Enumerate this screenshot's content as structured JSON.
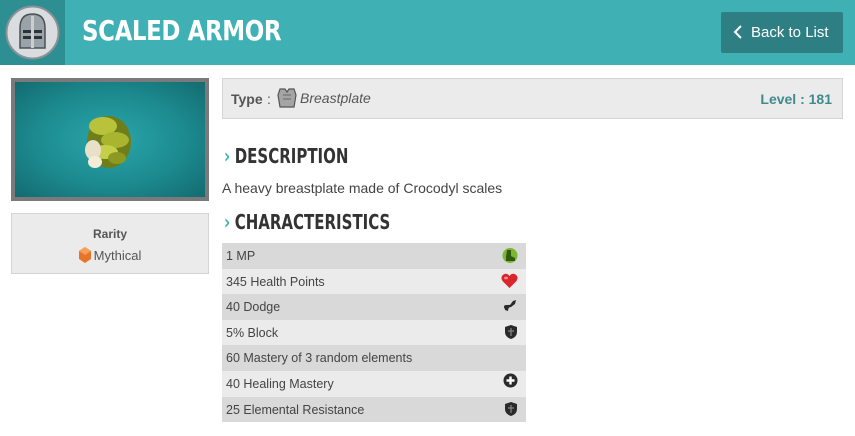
{
  "header": {
    "title": "Scaled Armor",
    "back_label": "Back to List",
    "helmet_icon": "knight-helmet-icon",
    "color": "#3fb1b5"
  },
  "item": {
    "image_icon": "scaled-breastplate-icon",
    "rarity_title": "Rarity",
    "rarity_value": "Mythical",
    "rarity_color": "#e8742a",
    "type_label": "Type",
    "type_colon": ":",
    "type_value": "Breastplate",
    "type_icon": "breastplate-icon",
    "level": "Level : 181"
  },
  "description": {
    "heading": "Description",
    "arrow": "›",
    "text": "A heavy breastplate made of Crocodyl scales"
  },
  "characteristics": {
    "heading": "Characteristics",
    "arrow": "›",
    "rows": [
      {
        "text": "1 MP",
        "icon": "mp-boot-icon"
      },
      {
        "text": "345 Health Points",
        "icon": "heart-icon"
      },
      {
        "text": "40 Dodge",
        "icon": "dodge-icon"
      },
      {
        "text": "5% Block",
        "icon": "shield-icon"
      },
      {
        "text": "60 Mastery of 3 random elements",
        "icon": ""
      },
      {
        "text": "40 Healing Mastery",
        "icon": "healing-cross-icon"
      },
      {
        "text": "25 Elemental Resistance",
        "icon": "shield-icon"
      }
    ]
  }
}
